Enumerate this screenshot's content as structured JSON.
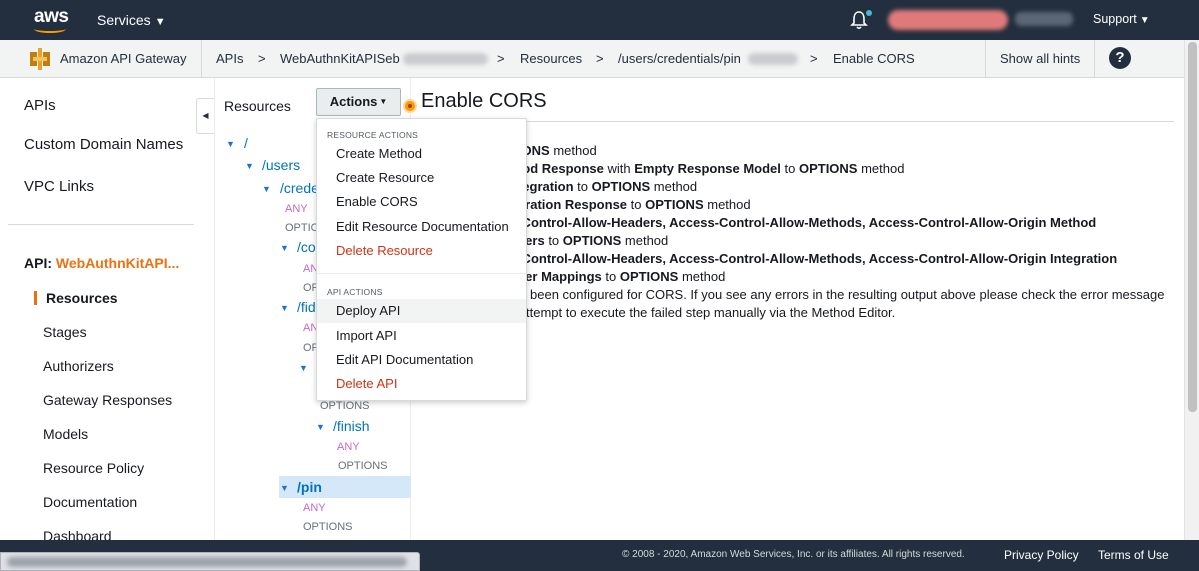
{
  "topbar": {
    "logo_text": "aws",
    "services_label": "Services",
    "support_label": "Support"
  },
  "breadcrumb": {
    "service": "Amazon API Gateway",
    "items": [
      "APIs",
      "WebAuthnKitAPISeb",
      "Resources",
      "/users/credentials/pin",
      "Enable CORS"
    ],
    "separator": ">",
    "hints_label": "Show all hints",
    "help_glyph": "?"
  },
  "leftnav": {
    "main_items": [
      "APIs",
      "Custom Domain Names",
      "VPC Links"
    ],
    "api_prefix": "API:",
    "api_name": "WebAuthnKitAPI...",
    "sub_items": [
      "Resources",
      "Stages",
      "Authorizers",
      "Gateway Responses",
      "Models",
      "Resource Policy",
      "Documentation",
      "Dashboard"
    ],
    "active_item": "Resources"
  },
  "resources": {
    "title": "Resources",
    "tree": {
      "root": "/",
      "users": "/users",
      "credentials": "/crede",
      "any": "ANY",
      "options": "OPTIONS",
      "co": "/co",
      "fid": "/fid",
      "finish": "/finish",
      "pin": "/pin"
    }
  },
  "actions": {
    "button_label": "Actions",
    "resource_heading": "RESOURCE ACTIONS",
    "resource_items": [
      "Create Method",
      "Create Resource",
      "Enable CORS",
      "Edit Resource Documentation",
      "Delete Resource"
    ],
    "api_heading": "API ACTIONS",
    "api_items": [
      "Deploy API",
      "Import API",
      "Edit API Documentation",
      "Delete API"
    ]
  },
  "content": {
    "title": "Enable CORS",
    "lines": [
      {
        "pre": "",
        "b1": "TIONS",
        "mid": " method",
        "b2": "",
        "post": ""
      },
      {
        "pre": "",
        "b1": "thod Response",
        "mid": " with ",
        "b2": "Empty Response Model",
        "post": " to ",
        "b3": "OPTIONS",
        "end": " method"
      },
      {
        "pre": "",
        "b1": "ntegration",
        "mid": " to ",
        "b2": "OPTIONS",
        "post": " method"
      },
      {
        "pre": "",
        "b1": "egration Response",
        "mid": " to ",
        "b2": "OPTIONS",
        "post": " method"
      },
      {
        "pre": "",
        "b1": "s-Control-Allow-Headers, Access-Control-Allow-Methods, Access-Control-Allow-Origin Method",
        "mid": "",
        "b2": "",
        "post": ""
      },
      {
        "pre": "",
        "b1": "aders",
        "mid": " to ",
        "b2": "OPTIONS",
        "post": " method"
      },
      {
        "pre": "",
        "b1": "s-Control-Allow-Headers, Access-Control-Allow-Methods, Access-Control-Allow-Origin Integration",
        "mid": "",
        "b2": "",
        "post": ""
      },
      {
        "pre": "",
        "b1": "ader Mappings",
        "mid": " to ",
        "b2": "OPTIONS",
        "post": " method"
      }
    ],
    "message_1": "been configured for CORS. If you see any errors in the resulting output above please check the error message",
    "message_2": "ttempt to execute the failed step manually via the Method Editor."
  },
  "footer": {
    "copyright": "© 2008 - 2020, Amazon Web Services, Inc. or its affiliates. All rights reserved.",
    "privacy": "Privacy Policy",
    "terms": "Terms of Use"
  },
  "colors": {
    "topbar": "#232f3e",
    "accent": "#ec7211",
    "link": "#0073bb",
    "danger": "#d13212"
  }
}
